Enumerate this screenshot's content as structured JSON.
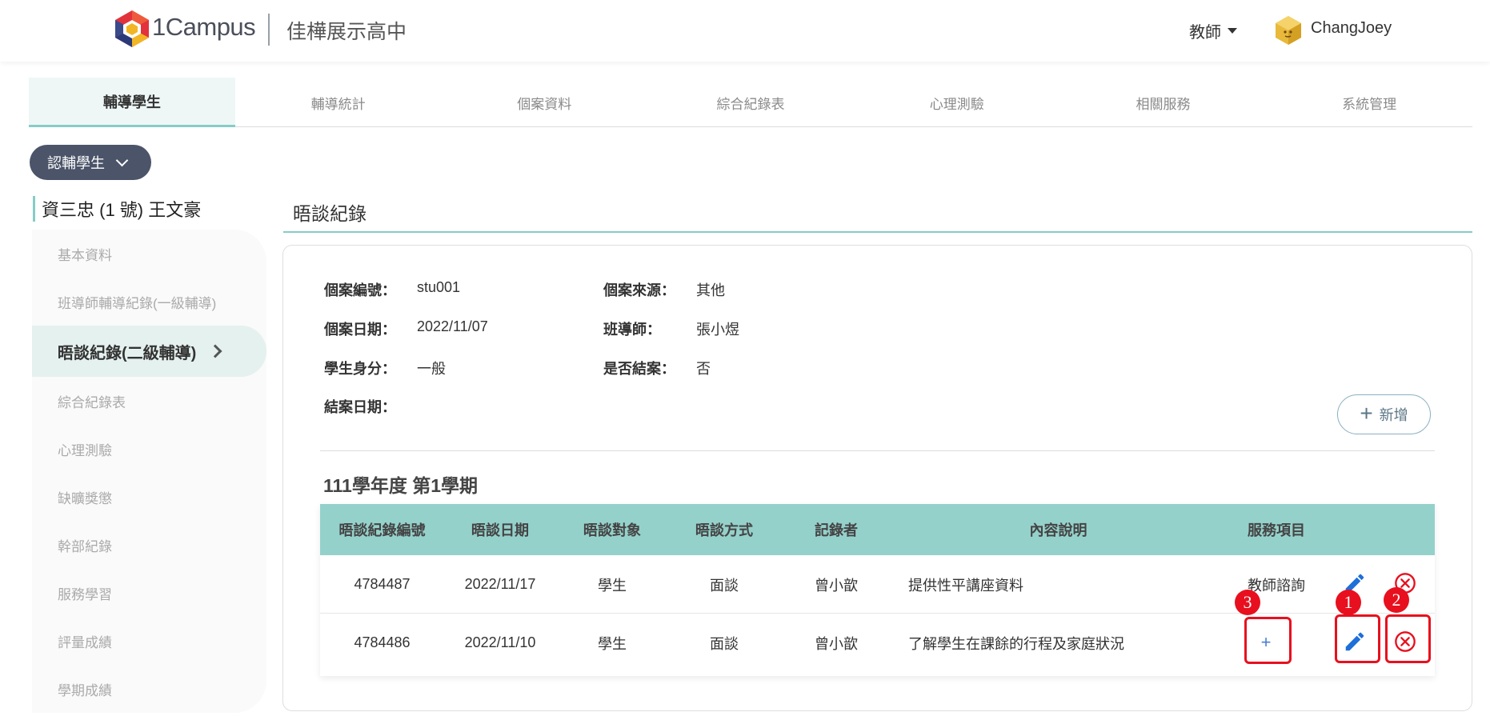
{
  "header": {
    "brand": "1Campus",
    "school": "佳樺展示高中",
    "role": "教師",
    "username": "ChangJoey"
  },
  "nav": {
    "items": [
      "輔導學生",
      "輔導統計",
      "個案資料",
      "綜合紀錄表",
      "心理測驗",
      "相關服務",
      "系統管理"
    ]
  },
  "selector": {
    "label": "認輔學生"
  },
  "student": {
    "label": "資三忠 (1 號)  王文豪"
  },
  "sidebar": {
    "items": [
      "基本資料",
      "班導師輔導紀錄(一級輔導)",
      "晤談紀錄(二級輔導)",
      "綜合紀錄表",
      "心理測驗",
      "缺曠獎懲",
      "幹部紀錄",
      "服務學習",
      "評量成績",
      "學期成績"
    ]
  },
  "main": {
    "title": "晤談紀錄",
    "fields": {
      "case_no_label": "個案編號：",
      "case_no": "stu001",
      "source_label": "個案來源：",
      "source": "其他",
      "date_label": "個案日期：",
      "date": "2022/11/07",
      "teacher_label": "班導師：",
      "teacher": "張小煜",
      "identity_label": "學生身分：",
      "identity": "一般",
      "closed_label": "是否結案：",
      "closed": "否",
      "close_date_label": "結案日期：",
      "close_date": ""
    },
    "add_label": "新增",
    "semester": "111學年度 第1學期",
    "table": {
      "headers": [
        "晤談紀錄編號",
        "晤談日期",
        "晤談對象",
        "晤談方式",
        "記錄者",
        "內容說明",
        "服務項目"
      ],
      "rows": [
        [
          "4784487",
          "2022/11/17",
          "學生",
          "面談",
          "曾小歆",
          "提供性平講座資料",
          "教師諮詢"
        ],
        [
          "4784486",
          "2022/11/10",
          "學生",
          "面談",
          "曾小歆",
          "了解學生在課餘的行程及家庭狀況",
          ""
        ]
      ]
    },
    "row2_add_symbol": "+"
  },
  "annotations": [
    "1",
    "2",
    "3"
  ],
  "colors": {
    "accent": "#86cdc6",
    "table_header": "#95d1cb",
    "selector_bg": "#4b5468",
    "edit_icon": "#1e6fd9",
    "delete_icon": "#e8101e",
    "annotation_red": "#e8101e"
  }
}
